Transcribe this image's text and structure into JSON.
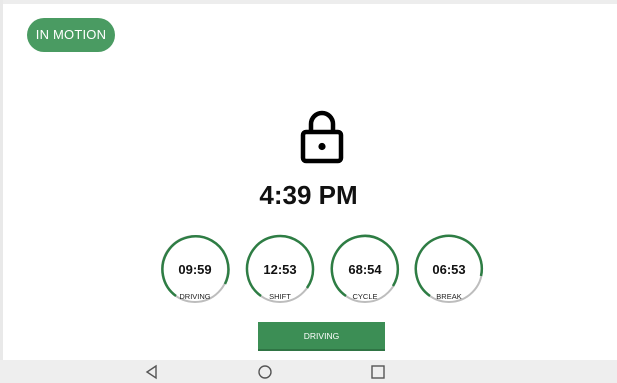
{
  "status": {
    "motion_label": "IN MOTION"
  },
  "clock": {
    "time": "4:39 PM"
  },
  "timers": [
    {
      "value": "09:59",
      "label": "DRIVING"
    },
    {
      "value": "12:53",
      "label": "SHIFT"
    },
    {
      "value": "68:54",
      "label": "CYCLE"
    },
    {
      "value": "06:53",
      "label": "BREAK"
    }
  ],
  "duty_status": {
    "label": "DRIVING"
  },
  "colors": {
    "accent": "#4a9b62",
    "ring": "#2e7d44",
    "ring_track": "#bdbdbd"
  },
  "icons": [
    "lock-icon",
    "back-icon",
    "home-icon",
    "recents-icon"
  ],
  "navbar": [
    "back",
    "home",
    "recents"
  ]
}
